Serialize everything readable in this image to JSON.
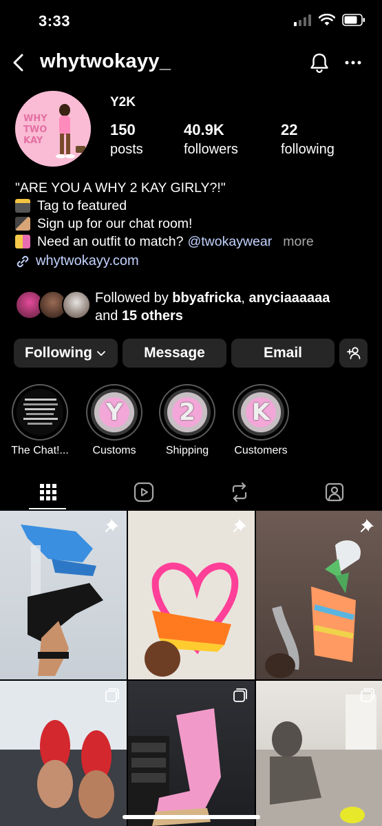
{
  "status_bar": {
    "time": "3:33"
  },
  "header": {
    "username": "whytwokayy_"
  },
  "profile": {
    "display_name": "Y2K",
    "stats": [
      {
        "value": "150",
        "label": "posts"
      },
      {
        "value": "40.9K",
        "label": "followers"
      },
      {
        "value": "22",
        "label": "following"
      }
    ]
  },
  "bio": {
    "line1": "\"ARE YOU A WHY 2 KAY GIRLY?!\"",
    "line2": "Tag to featured",
    "line3": "Sign up for our chat room!",
    "line4": "Need an outfit to match?",
    "mention": "@twokaywear",
    "more": "more",
    "link": "whytwokayy.com"
  },
  "followed_by": {
    "prefix": "Followed by",
    "user1": "bbyafricka",
    "separator": ",",
    "user2": "anyciaaaaaa",
    "and": "and",
    "others": "15 others"
  },
  "actions": {
    "following": "Following",
    "message": "Message",
    "email": "Email"
  },
  "highlights": [
    {
      "label": "The Chat!...",
      "glyph": ""
    },
    {
      "label": "Customs",
      "glyph": "Y"
    },
    {
      "label": "Shipping",
      "glyph": "2"
    },
    {
      "label": "Customers",
      "glyph": "K"
    }
  ],
  "tabs": [
    "grid-icon",
    "reels-icon",
    "reposts-icon",
    "tagged-icon"
  ],
  "grid_posts": [
    {
      "badge": "pin-icon"
    },
    {
      "badge": "pin-icon"
    },
    {
      "badge": "pin-icon"
    },
    {
      "badge": "carousel-icon"
    },
    {
      "badge": "carousel-icon"
    },
    {
      "badge": "carousel-icon"
    }
  ],
  "colors": {
    "background": "#000000",
    "button": "#262626",
    "link": "#c3d3ff",
    "muted": "#a8a8a8",
    "highlight_pink": "#f2a7d8"
  }
}
